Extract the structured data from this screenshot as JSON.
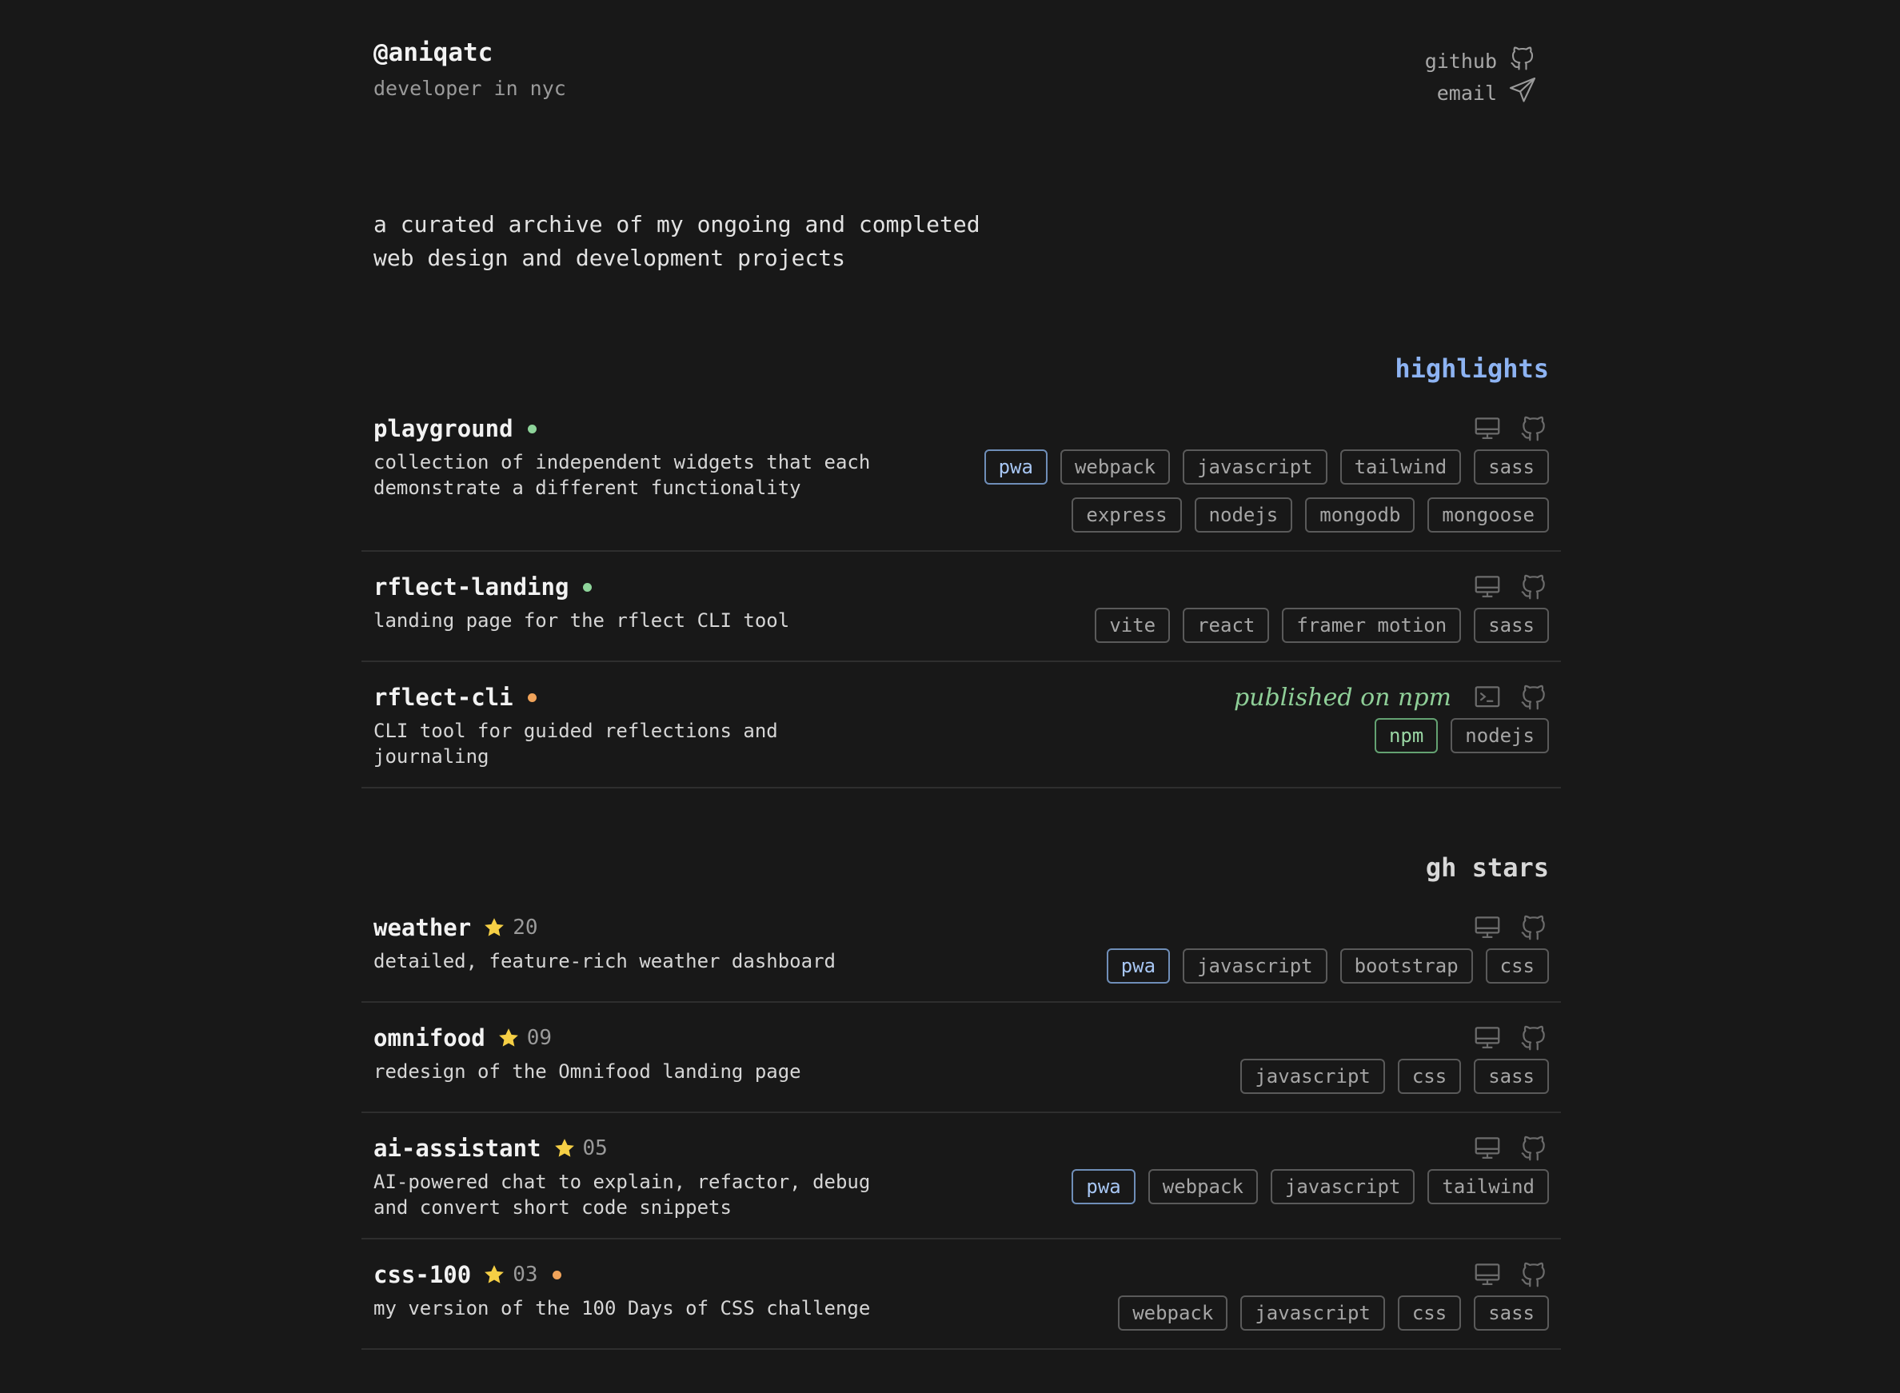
{
  "header": {
    "handle": "@aniqatc",
    "tagline": "developer in nyc",
    "links": [
      {
        "label": "github",
        "icon": "github-icon"
      },
      {
        "label": "email",
        "icon": "send-icon"
      }
    ]
  },
  "intro": {
    "line1": "a curated archive of my ongoing and completed",
    "line2": "web design and development projects"
  },
  "highlights": {
    "title": "highlights",
    "projects": [
      {
        "name": "playground",
        "status": "green",
        "desc_line1": "collection of independent widgets that each",
        "desc_line2": "demonstrate a different functionality",
        "tags": [
          "pwa",
          "webpack",
          "javascript",
          "tailwind",
          "sass",
          "express",
          "nodejs",
          "mongodb",
          "mongoose"
        ]
      },
      {
        "name": "rflect-landing",
        "status": "green",
        "desc_line1": "landing page for the rflect CLI tool",
        "tags": [
          "vite",
          "react",
          "framer motion",
          "sass"
        ]
      },
      {
        "name": "rflect-cli",
        "status": "orange",
        "note": "published on npm",
        "desc_line1": "CLI tool for guided reflections and",
        "desc_line2": "journaling",
        "tags": [
          "npm",
          "nodejs"
        ]
      }
    ]
  },
  "stars": {
    "title": "gh stars",
    "projects": [
      {
        "name": "weather",
        "stars": "20",
        "desc_line1": "detailed, feature-rich weather dashboard",
        "tags": [
          "pwa",
          "javascript",
          "bootstrap",
          "css"
        ]
      },
      {
        "name": "omnifood",
        "stars": "09",
        "desc_line1": "redesign of the Omnifood landing page",
        "tags": [
          "javascript",
          "css",
          "sass"
        ]
      },
      {
        "name": "ai-assistant",
        "stars": "05",
        "desc_line1": "AI-powered chat to explain, refactor, debug",
        "desc_line2": "and convert short code snippets",
        "tags": [
          "pwa",
          "webpack",
          "javascript",
          "tailwind"
        ]
      },
      {
        "name": "css-100",
        "stars": "03",
        "status": "orange",
        "desc_line1": "my version of the 100 Days of CSS challenge",
        "tags": [
          "webpack",
          "javascript",
          "css",
          "sass"
        ]
      }
    ]
  },
  "colors": {
    "background": "#181818",
    "accent_blue": "#8db3f2",
    "status_green": "#8ed49a",
    "status_orange": "#f0a35a",
    "star": "#f5cf45"
  }
}
